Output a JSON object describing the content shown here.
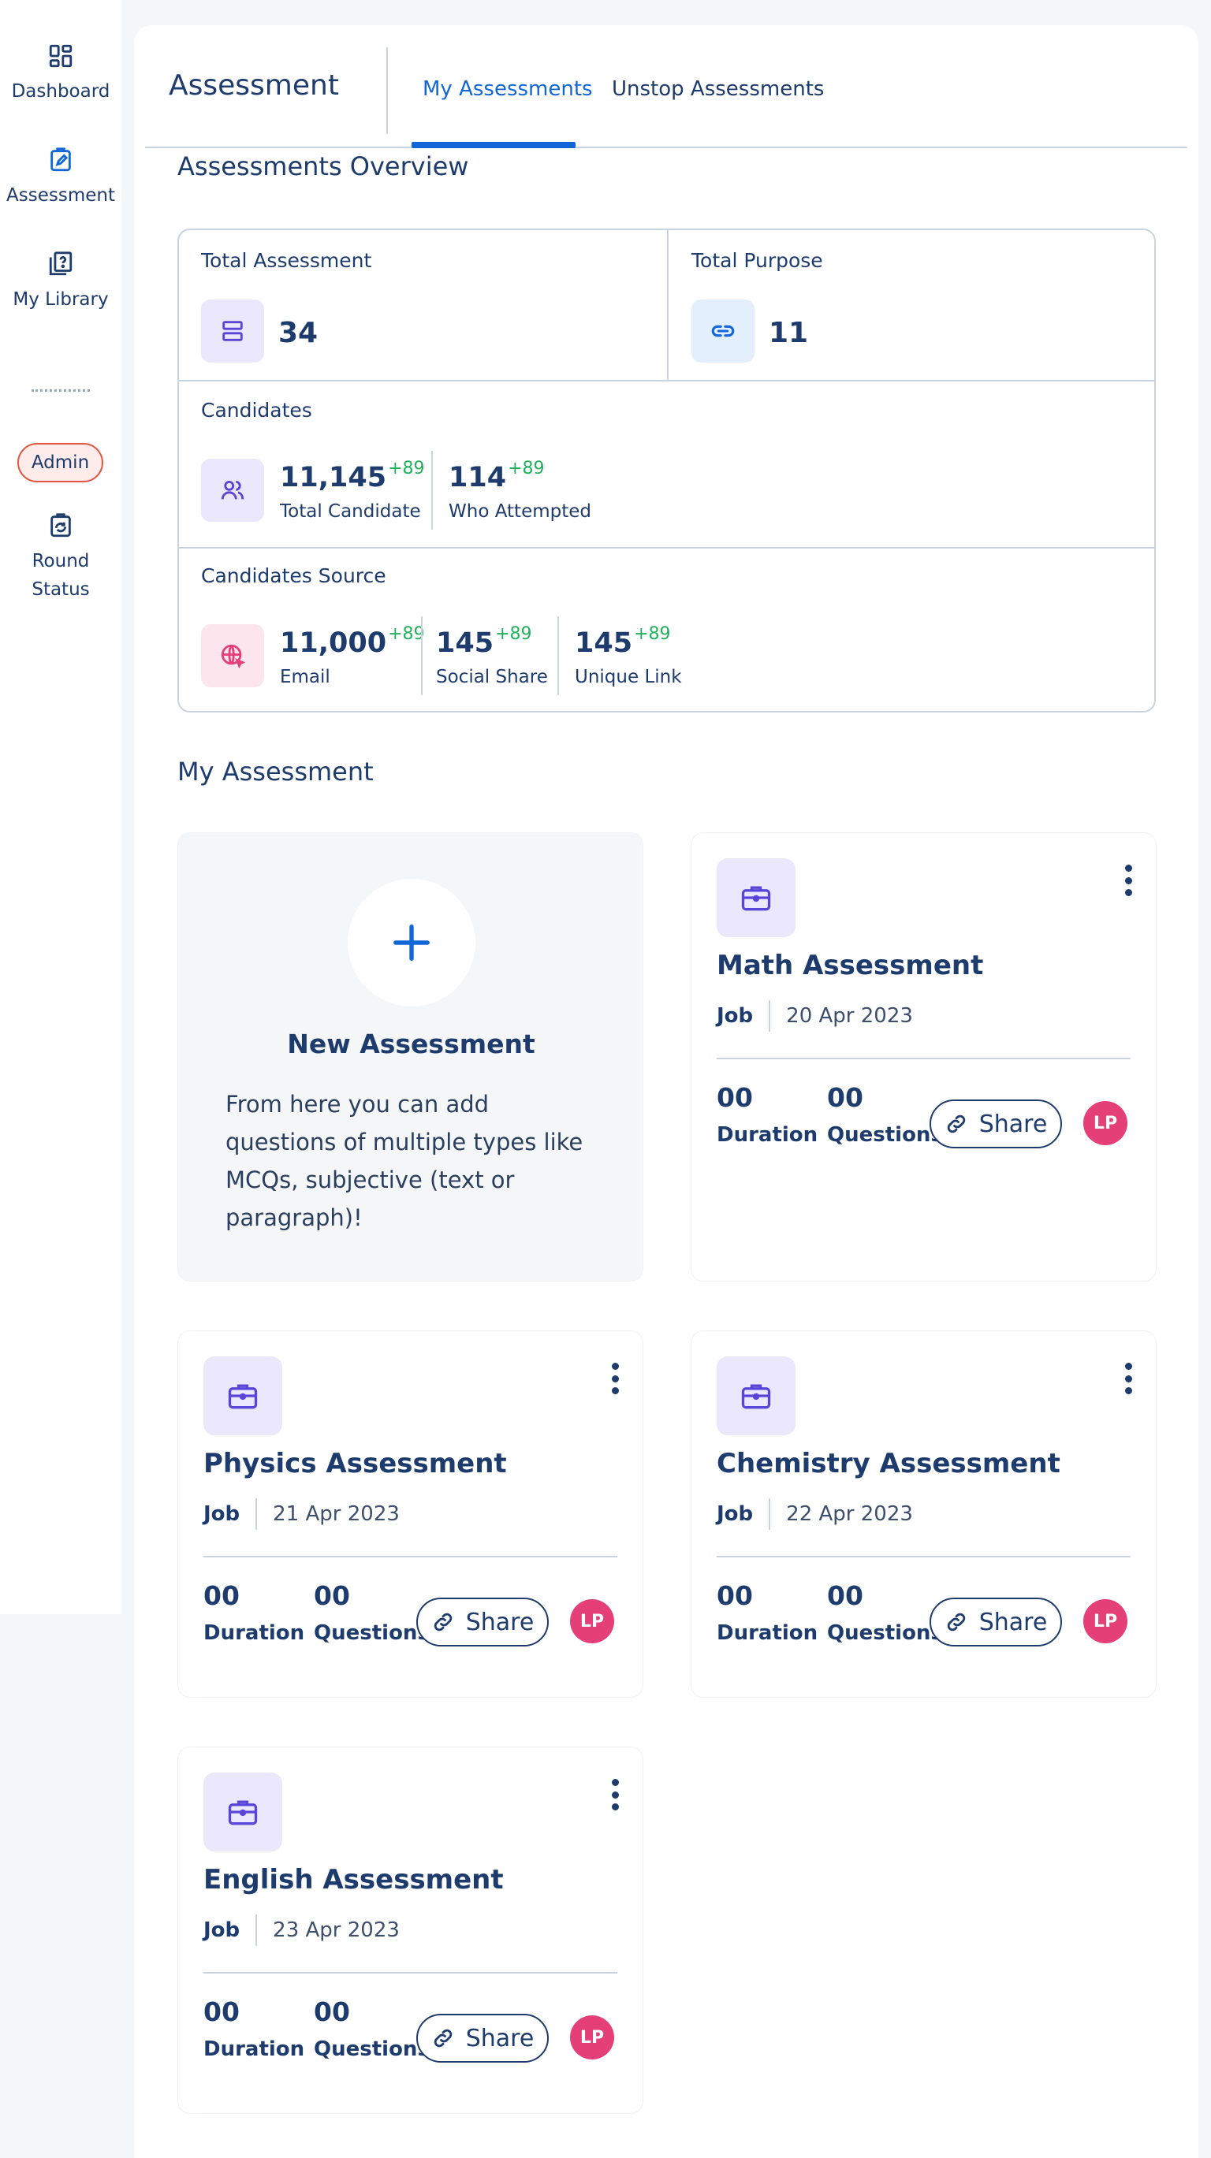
{
  "sidebar": {
    "items": [
      {
        "label": "Dashboard",
        "icon": "dashboard-icon"
      },
      {
        "label": "Assessment",
        "icon": "assessment-icon"
      },
      {
        "label": "My Library",
        "icon": "library-icon"
      }
    ],
    "badge": "Admin",
    "round_status": {
      "line1": "Round",
      "line2": "Status",
      "icon": "round-status-icon"
    }
  },
  "header": {
    "title": "Assessment",
    "tabs": [
      {
        "label": "My Assessments",
        "active": true
      },
      {
        "label": "Unstop Assessments",
        "active": false
      }
    ]
  },
  "overview": {
    "title": "Assessments Overview",
    "total_assessment": {
      "label": "Total Assessment",
      "value": "34"
    },
    "total_purpose": {
      "label": "Total Purpose",
      "value": "11"
    },
    "candidates": {
      "label": "Candidates",
      "total": {
        "value": "11,145",
        "delta": "+89",
        "label": "Total Candidate"
      },
      "attempted": {
        "value": "114",
        "delta": "+89",
        "label": "Who Attempted"
      }
    },
    "source": {
      "label": "Candidates Source",
      "email": {
        "value": "11,000",
        "delta": "+89",
        "label": "Email"
      },
      "social": {
        "value": "145",
        "delta": "+89",
        "label": "Social Share"
      },
      "link": {
        "value": "145",
        "delta": "+89",
        "label": "Unique Link"
      }
    }
  },
  "my_assessment": {
    "title": "My Assessment",
    "new_card": {
      "title": "New Assessment",
      "description": "From here you can add questions of multiple types like MCQs, subjective (text or paragraph)!"
    },
    "cards": [
      {
        "title": "Math Assessment",
        "type": "Job",
        "date": "20 Apr 2023",
        "duration": "00",
        "duration_label": "Duration",
        "questions": "00",
        "questions_label": "Questions",
        "share": "Share",
        "avatar": "LP"
      },
      {
        "title": "Physics Assessment",
        "type": "Job",
        "date": "21 Apr 2023",
        "duration": "00",
        "duration_label": "Duration",
        "questions": "00",
        "questions_label": "Questions",
        "share": "Share",
        "avatar": "LP"
      },
      {
        "title": "Chemistry Assessment",
        "type": "Job",
        "date": "22 Apr 2023",
        "duration": "00",
        "duration_label": "Duration",
        "questions": "00",
        "questions_label": "Questions",
        "share": "Share",
        "avatar": "LP"
      },
      {
        "title": "English Assessment",
        "type": "Job",
        "date": "23 Apr 2023",
        "duration": "00",
        "duration_label": "Duration",
        "questions": "00",
        "questions_label": "Questions",
        "share": "Share",
        "avatar": "LP"
      }
    ]
  },
  "colors": {
    "primary": "#1d3b6c",
    "accent": "#1266d6",
    "delta_green": "#21b05a",
    "avatar_pink": "#e43f76",
    "icon_purple": "#5a45d8",
    "icon_bg_purple": "#ebe7fc",
    "icon_bg_blue": "#e3effd",
    "icon_bg_pink": "#fde5ee"
  }
}
